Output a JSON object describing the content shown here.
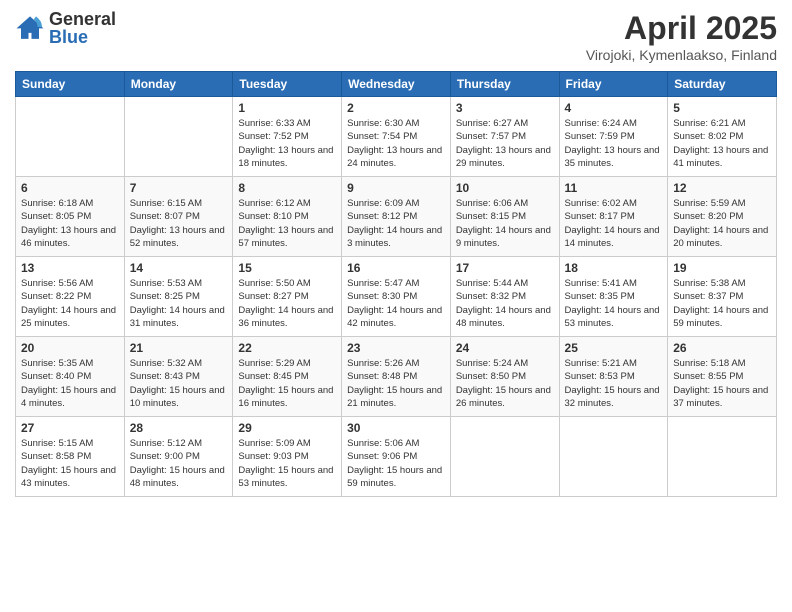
{
  "header": {
    "logo_general": "General",
    "logo_blue": "Blue",
    "title": "April 2025",
    "subtitle": "Virojoki, Kymenlaakso, Finland"
  },
  "calendar": {
    "days_of_week": [
      "Sunday",
      "Monday",
      "Tuesday",
      "Wednesday",
      "Thursday",
      "Friday",
      "Saturday"
    ],
    "weeks": [
      [
        {
          "day": "",
          "info": ""
        },
        {
          "day": "",
          "info": ""
        },
        {
          "day": "1",
          "info": "Sunrise: 6:33 AM\nSunset: 7:52 PM\nDaylight: 13 hours and 18 minutes."
        },
        {
          "day": "2",
          "info": "Sunrise: 6:30 AM\nSunset: 7:54 PM\nDaylight: 13 hours and 24 minutes."
        },
        {
          "day": "3",
          "info": "Sunrise: 6:27 AM\nSunset: 7:57 PM\nDaylight: 13 hours and 29 minutes."
        },
        {
          "day": "4",
          "info": "Sunrise: 6:24 AM\nSunset: 7:59 PM\nDaylight: 13 hours and 35 minutes."
        },
        {
          "day": "5",
          "info": "Sunrise: 6:21 AM\nSunset: 8:02 PM\nDaylight: 13 hours and 41 minutes."
        }
      ],
      [
        {
          "day": "6",
          "info": "Sunrise: 6:18 AM\nSunset: 8:05 PM\nDaylight: 13 hours and 46 minutes."
        },
        {
          "day": "7",
          "info": "Sunrise: 6:15 AM\nSunset: 8:07 PM\nDaylight: 13 hours and 52 minutes."
        },
        {
          "day": "8",
          "info": "Sunrise: 6:12 AM\nSunset: 8:10 PM\nDaylight: 13 hours and 57 minutes."
        },
        {
          "day": "9",
          "info": "Sunrise: 6:09 AM\nSunset: 8:12 PM\nDaylight: 14 hours and 3 minutes."
        },
        {
          "day": "10",
          "info": "Sunrise: 6:06 AM\nSunset: 8:15 PM\nDaylight: 14 hours and 9 minutes."
        },
        {
          "day": "11",
          "info": "Sunrise: 6:02 AM\nSunset: 8:17 PM\nDaylight: 14 hours and 14 minutes."
        },
        {
          "day": "12",
          "info": "Sunrise: 5:59 AM\nSunset: 8:20 PM\nDaylight: 14 hours and 20 minutes."
        }
      ],
      [
        {
          "day": "13",
          "info": "Sunrise: 5:56 AM\nSunset: 8:22 PM\nDaylight: 14 hours and 25 minutes."
        },
        {
          "day": "14",
          "info": "Sunrise: 5:53 AM\nSunset: 8:25 PM\nDaylight: 14 hours and 31 minutes."
        },
        {
          "day": "15",
          "info": "Sunrise: 5:50 AM\nSunset: 8:27 PM\nDaylight: 14 hours and 36 minutes."
        },
        {
          "day": "16",
          "info": "Sunrise: 5:47 AM\nSunset: 8:30 PM\nDaylight: 14 hours and 42 minutes."
        },
        {
          "day": "17",
          "info": "Sunrise: 5:44 AM\nSunset: 8:32 PM\nDaylight: 14 hours and 48 minutes."
        },
        {
          "day": "18",
          "info": "Sunrise: 5:41 AM\nSunset: 8:35 PM\nDaylight: 14 hours and 53 minutes."
        },
        {
          "day": "19",
          "info": "Sunrise: 5:38 AM\nSunset: 8:37 PM\nDaylight: 14 hours and 59 minutes."
        }
      ],
      [
        {
          "day": "20",
          "info": "Sunrise: 5:35 AM\nSunset: 8:40 PM\nDaylight: 15 hours and 4 minutes."
        },
        {
          "day": "21",
          "info": "Sunrise: 5:32 AM\nSunset: 8:43 PM\nDaylight: 15 hours and 10 minutes."
        },
        {
          "day": "22",
          "info": "Sunrise: 5:29 AM\nSunset: 8:45 PM\nDaylight: 15 hours and 16 minutes."
        },
        {
          "day": "23",
          "info": "Sunrise: 5:26 AM\nSunset: 8:48 PM\nDaylight: 15 hours and 21 minutes."
        },
        {
          "day": "24",
          "info": "Sunrise: 5:24 AM\nSunset: 8:50 PM\nDaylight: 15 hours and 26 minutes."
        },
        {
          "day": "25",
          "info": "Sunrise: 5:21 AM\nSunset: 8:53 PM\nDaylight: 15 hours and 32 minutes."
        },
        {
          "day": "26",
          "info": "Sunrise: 5:18 AM\nSunset: 8:55 PM\nDaylight: 15 hours and 37 minutes."
        }
      ],
      [
        {
          "day": "27",
          "info": "Sunrise: 5:15 AM\nSunset: 8:58 PM\nDaylight: 15 hours and 43 minutes."
        },
        {
          "day": "28",
          "info": "Sunrise: 5:12 AM\nSunset: 9:00 PM\nDaylight: 15 hours and 48 minutes."
        },
        {
          "day": "29",
          "info": "Sunrise: 5:09 AM\nSunset: 9:03 PM\nDaylight: 15 hours and 53 minutes."
        },
        {
          "day": "30",
          "info": "Sunrise: 5:06 AM\nSunset: 9:06 PM\nDaylight: 15 hours and 59 minutes."
        },
        {
          "day": "",
          "info": ""
        },
        {
          "day": "",
          "info": ""
        },
        {
          "day": "",
          "info": ""
        }
      ]
    ]
  }
}
